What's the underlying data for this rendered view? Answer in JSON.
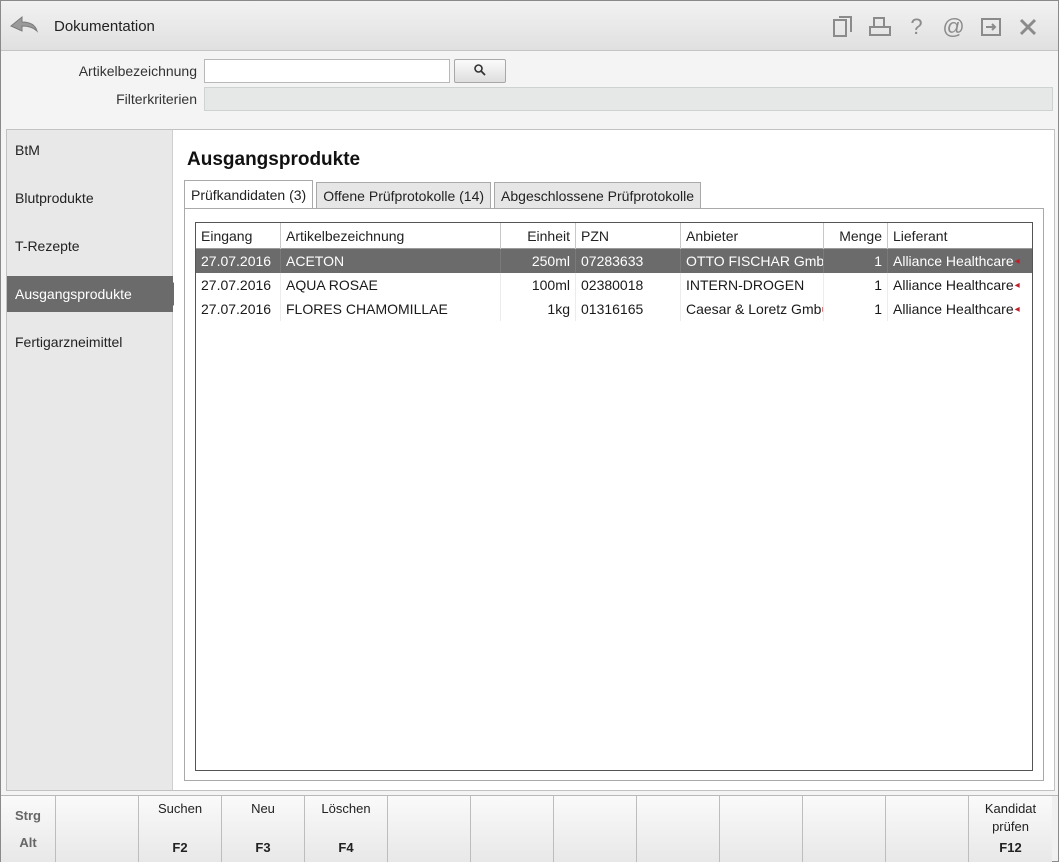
{
  "window": {
    "title": "Dokumentation"
  },
  "toolbar_icons": [
    "copy-icon",
    "print-icon",
    "help-icon",
    "email-icon",
    "export-icon",
    "close-icon"
  ],
  "search": {
    "artikel_label": "Artikelbezeichnung",
    "artikel_value": "",
    "filter_label": "Filterkriterien",
    "filter_value": ""
  },
  "sidebar": {
    "items": [
      {
        "label": "BtM",
        "active": false
      },
      {
        "label": "Blutprodukte",
        "active": false
      },
      {
        "label": "T-Rezepte",
        "active": false
      },
      {
        "label": "Ausgangsprodukte",
        "active": true
      },
      {
        "label": "Fertigarzneimittel",
        "active": false
      }
    ]
  },
  "main": {
    "heading": "Ausgangsprodukte",
    "tabs": [
      {
        "label": "Prüfkandidaten (3)",
        "active": true
      },
      {
        "label": "Offene Prüfprotokolle (14)",
        "active": false
      },
      {
        "label": "Abgeschlossene Prüfprotokolle",
        "active": false
      }
    ]
  },
  "table": {
    "columns": [
      "Eingang",
      "Artikelbezeichnung",
      "Einheit",
      "PZN",
      "Anbieter",
      "Menge",
      "Lieferant"
    ],
    "rows": [
      {
        "eingang": "27.07.2016",
        "artikel": "ACETON",
        "einheit": "250ml",
        "pzn": "07283633",
        "anbieter": "OTTO FISCHAR Gmb",
        "menge": "1",
        "lieferant": "Alliance Healthcare",
        "selected": true
      },
      {
        "eingang": "27.07.2016",
        "artikel": "AQUA ROSAE",
        "einheit": "100ml",
        "pzn": "02380018",
        "anbieter": "INTERN-DROGEN",
        "menge": "1",
        "lieferant": "Alliance Healthcare",
        "selected": false
      },
      {
        "eingang": "27.07.2016",
        "artikel": "FLORES CHAMOMILLAE",
        "einheit": "1kg",
        "pzn": "01316165",
        "anbieter": "Caesar & Loretz Gmb",
        "menge": "1",
        "lieferant": "Alliance Healthcare",
        "selected": false
      }
    ]
  },
  "fkeys": {
    "modifiers": [
      "Strg",
      "Alt"
    ],
    "keys": [
      {
        "label": "",
        "code": ""
      },
      {
        "label": "Suchen",
        "code": "F2"
      },
      {
        "label": "Neu",
        "code": "F3"
      },
      {
        "label": "Löschen",
        "code": "F4"
      },
      {
        "label": "",
        "code": ""
      },
      {
        "label": "",
        "code": ""
      },
      {
        "label": "",
        "code": ""
      },
      {
        "label": "",
        "code": ""
      },
      {
        "label": "",
        "code": ""
      },
      {
        "label": "",
        "code": ""
      },
      {
        "label": "",
        "code": ""
      },
      {
        "label": "Kandidat prüfen",
        "code": "F12"
      }
    ]
  }
}
